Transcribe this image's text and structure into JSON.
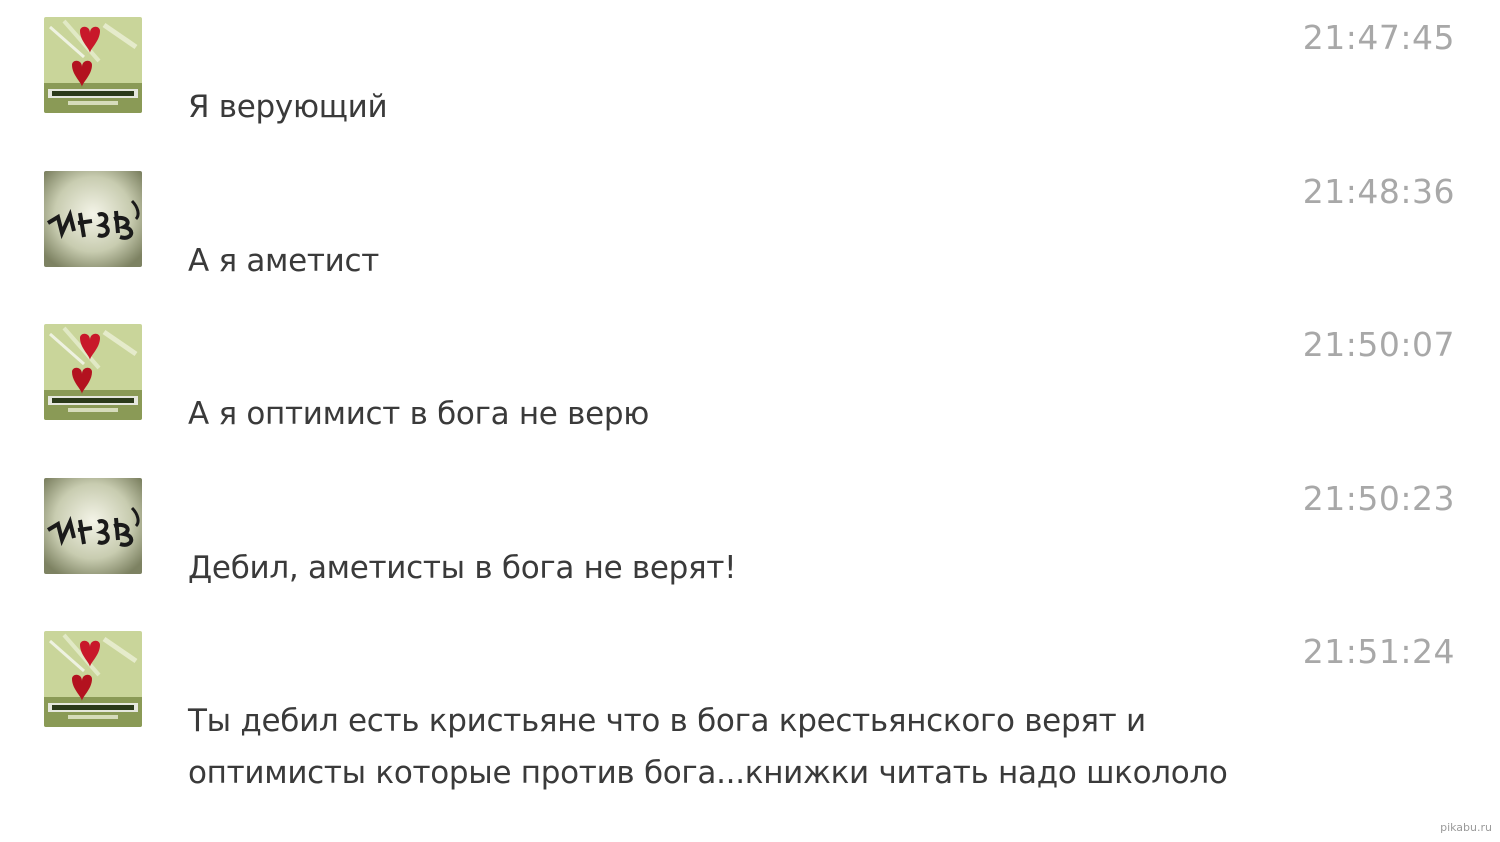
{
  "messages": [
    {
      "avatar": "heart-avatar",
      "time": "21:47:45",
      "text": "Я верующий"
    },
    {
      "avatar": "graffiti-avatar",
      "time": "21:48:36",
      "text": "А я аметист"
    },
    {
      "avatar": "heart-avatar",
      "time": "21:50:07",
      "text": "А я оптимист в бога не верю"
    },
    {
      "avatar": "graffiti-avatar",
      "time": "21:50:23",
      "text": "Дебил, аметисты в бога не верят!"
    },
    {
      "avatar": "heart-avatar",
      "time": "21:51:24",
      "text": "Ты дебил есть кристьяне что в бога крестьянского верят и оптимисты которые против бога...книжки читать надо школоло"
    }
  ],
  "watermark": "pikabu.ru",
  "colors": {
    "timestamp": "#a8a8a8",
    "text": "#3a3a3a",
    "background": "#ffffff"
  }
}
